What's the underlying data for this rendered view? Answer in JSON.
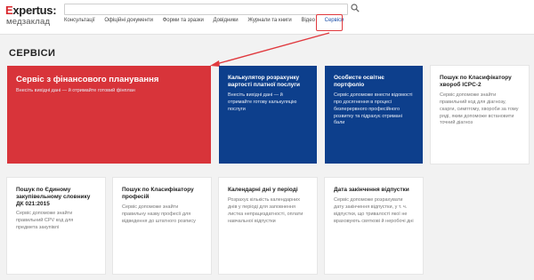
{
  "header": {
    "logo_name": "Expertus:",
    "logo_sub": "медзаклад",
    "nav": [
      "Консультації",
      "Офіційні документи",
      "Форми та зразки",
      "Довідники",
      "Журнали та книги",
      "Відео",
      "Сервіси"
    ]
  },
  "page": {
    "title": "СЕРВІСИ"
  },
  "cards": [
    {
      "title": "Сервіс з фінансового планування",
      "desc": "Внесіть вихідні дані — й отримайте готовий фінплан"
    },
    {
      "title": "Калькулятор розрахунку вартості платної послуги",
      "desc": "Внесіть вихідні дані — й отримайте готову калькуляцію послуги"
    },
    {
      "title": "Особисте освітнє портфоліо",
      "desc": "Сервіс допоможе внести відомості про досягнення в процесі безперервного професійного розвитку та підрахує отримані бали"
    },
    {
      "title": "Пошук по Класифікатору хвороб ICPC-2",
      "desc": "Сервіс допоможе знайти правильний код для діагнозу, скарги, симптому, хвороби за тому ряді, яким допоможе встановити точний діагноз"
    },
    {
      "title": "Пошук по Єдиному закупівельному словнику ДК 021:2015",
      "desc": "Сервіс допоможе знайти правильний CPV код для предмета закупівлі"
    },
    {
      "title": "Пошук по Класифікатору професій",
      "desc": "Сервіс допоможе знайти правильну назву професії для відведення до штатного розпису"
    },
    {
      "title": "Календарні дні у періоді",
      "desc": "Розрахує кількість календарних днів у періоді для заповнення листка непрацездатності, оплати навчальної відпустки"
    },
    {
      "title": "Дата закінчення відпустки",
      "desc": "Сервіс допоможе розрахувати дату закінчення відпустки, у т. ч. відпустки, що тривалості якої не враховують святкові й неробочі дні"
    }
  ]
}
